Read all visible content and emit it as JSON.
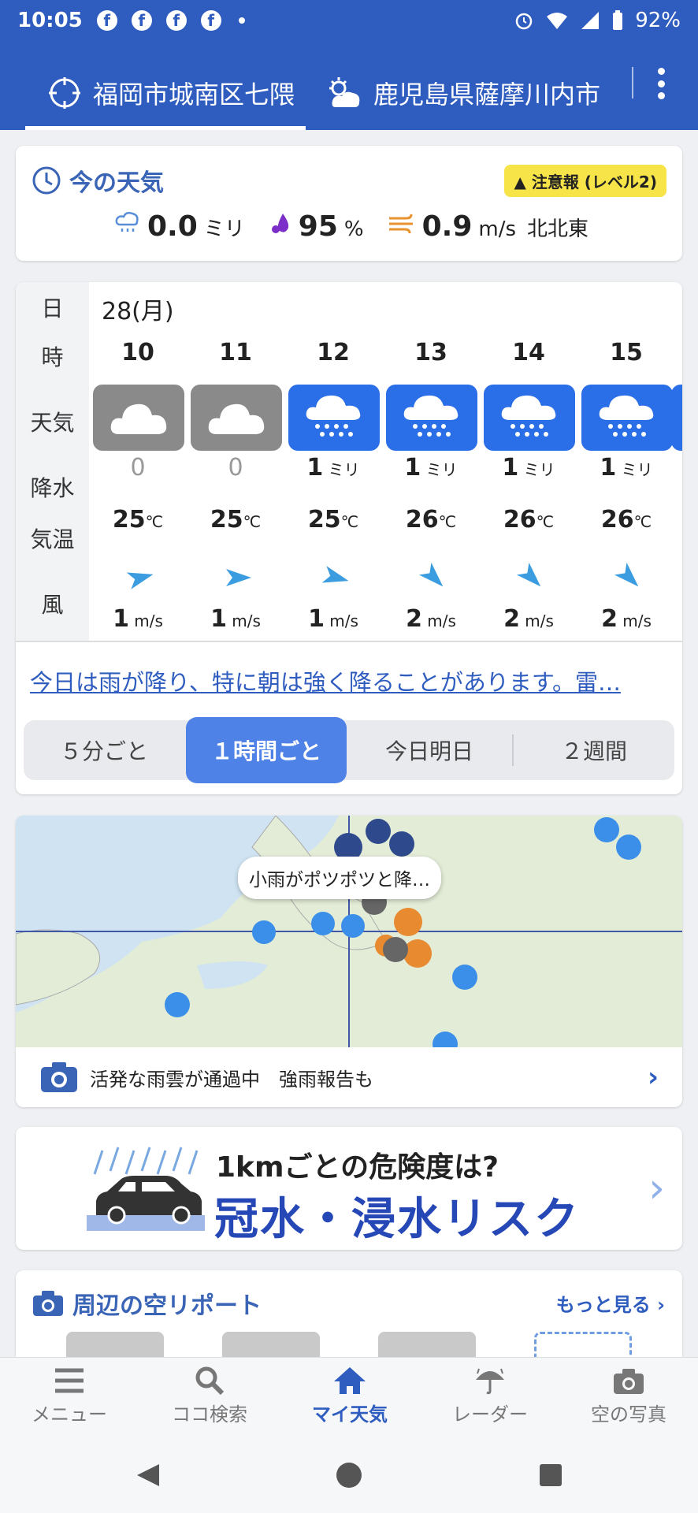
{
  "status_bar": {
    "time": "10:05",
    "battery": "92%"
  },
  "header": {
    "tabs": [
      {
        "label": "福岡市城南区七隈",
        "icon": "location-target-icon"
      },
      {
        "label": "鹿児島県薩摩川内市",
        "icon": "partly-cloudy-icon"
      }
    ]
  },
  "current": {
    "title": "今の天気",
    "alert": "注意報 (レベル2)",
    "precip_value": "0.0",
    "precip_unit": "ミリ",
    "humidity_value": "95",
    "humidity_unit": "%",
    "wind_value": "0.9",
    "wind_unit": "m/s",
    "wind_dir": "北北東"
  },
  "forecast": {
    "labels": {
      "day": "日",
      "hour": "時",
      "weather": "天気",
      "precip": "降水",
      "temp": "気温",
      "wind": "風"
    },
    "date": "28(月)",
    "hours": [
      {
        "hour": "10",
        "weather": "cloudy",
        "precip": "0",
        "precip_unit": "",
        "temp": "25",
        "temp_unit": "℃",
        "wind": "1",
        "wind_unit": "m/s"
      },
      {
        "hour": "11",
        "weather": "cloudy",
        "precip": "0",
        "precip_unit": "",
        "temp": "25",
        "temp_unit": "℃",
        "wind": "1",
        "wind_unit": "m/s"
      },
      {
        "hour": "12",
        "weather": "rain",
        "precip": "1",
        "precip_unit": "ミリ",
        "temp": "25",
        "temp_unit": "℃",
        "wind": "1",
        "wind_unit": "m/s"
      },
      {
        "hour": "13",
        "weather": "rain",
        "precip": "1",
        "precip_unit": "ミリ",
        "temp": "26",
        "temp_unit": "℃",
        "wind": "2",
        "wind_unit": "m/s"
      },
      {
        "hour": "14",
        "weather": "rain",
        "precip": "1",
        "precip_unit": "ミリ",
        "temp": "26",
        "temp_unit": "℃",
        "wind": "2",
        "wind_unit": "m/s"
      },
      {
        "hour": "15",
        "weather": "rain",
        "precip": "1",
        "precip_unit": "ミリ",
        "temp": "26",
        "temp_unit": "℃",
        "wind": "2",
        "wind_unit": "m/s"
      }
    ],
    "summary_link": "今日は雨が降り、特に朝は強く降ることがあります。雷…",
    "segments": [
      "５分ごと",
      "１時間ごと",
      "今日明日",
      "２週間"
    ],
    "active_segment": "１時間ごと"
  },
  "map": {
    "bubble": "小雨がポツポツと降…",
    "footer": "活発な雨雲が通過中　強雨報告も"
  },
  "banner": {
    "question": "1kmごとの危険度は?",
    "main": "冠水・浸水リスク"
  },
  "sky_report": {
    "title": "周辺の空リポート",
    "more": "もっと見る"
  },
  "bottom_nav": [
    {
      "label": "メニュー",
      "icon": "menu-icon"
    },
    {
      "label": "ココ検索",
      "icon": "search-icon"
    },
    {
      "label": "マイ天気",
      "icon": "home-icon"
    },
    {
      "label": "レーダー",
      "icon": "radar-umbrella-icon"
    },
    {
      "label": "空の写真",
      "icon": "camera-icon"
    }
  ],
  "colors": {
    "brand": "#2f5cbf",
    "rain_tile": "#2a6ee8",
    "cloudy_tile": "#8a8a8a",
    "alert": "#f7e449"
  }
}
